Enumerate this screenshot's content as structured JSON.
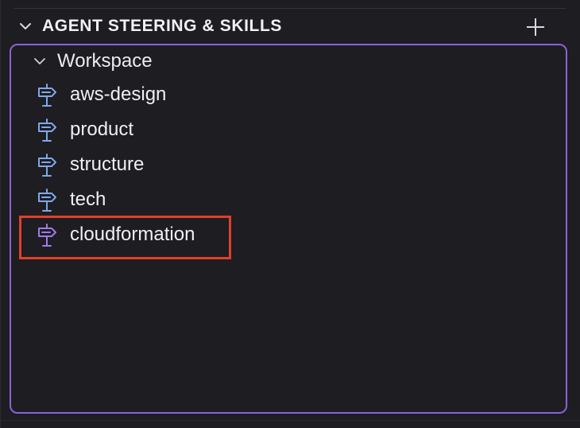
{
  "section": {
    "title": "AGENT STEERING & SKILLS",
    "add_icon": "plus-icon",
    "collapse_icon": "chevron-down-icon"
  },
  "tree": {
    "group_label": "Workspace",
    "group_icon": "chevron-down-icon",
    "items": [
      {
        "label": "aws-design",
        "icon": "signpost-icon",
        "color": "#7fa8e8"
      },
      {
        "label": "product",
        "icon": "signpost-icon",
        "color": "#7fa8e8"
      },
      {
        "label": "structure",
        "icon": "signpost-icon",
        "color": "#7fa8e8"
      },
      {
        "label": "tech",
        "icon": "signpost-icon",
        "color": "#7fa8e8"
      },
      {
        "label": "cloudformation",
        "icon": "signpost-icon",
        "color": "#a07ae6"
      }
    ]
  },
  "colors": {
    "panel_border": "#8a62d8",
    "highlight_border": "#e0402a",
    "background": "#1e1d22"
  }
}
